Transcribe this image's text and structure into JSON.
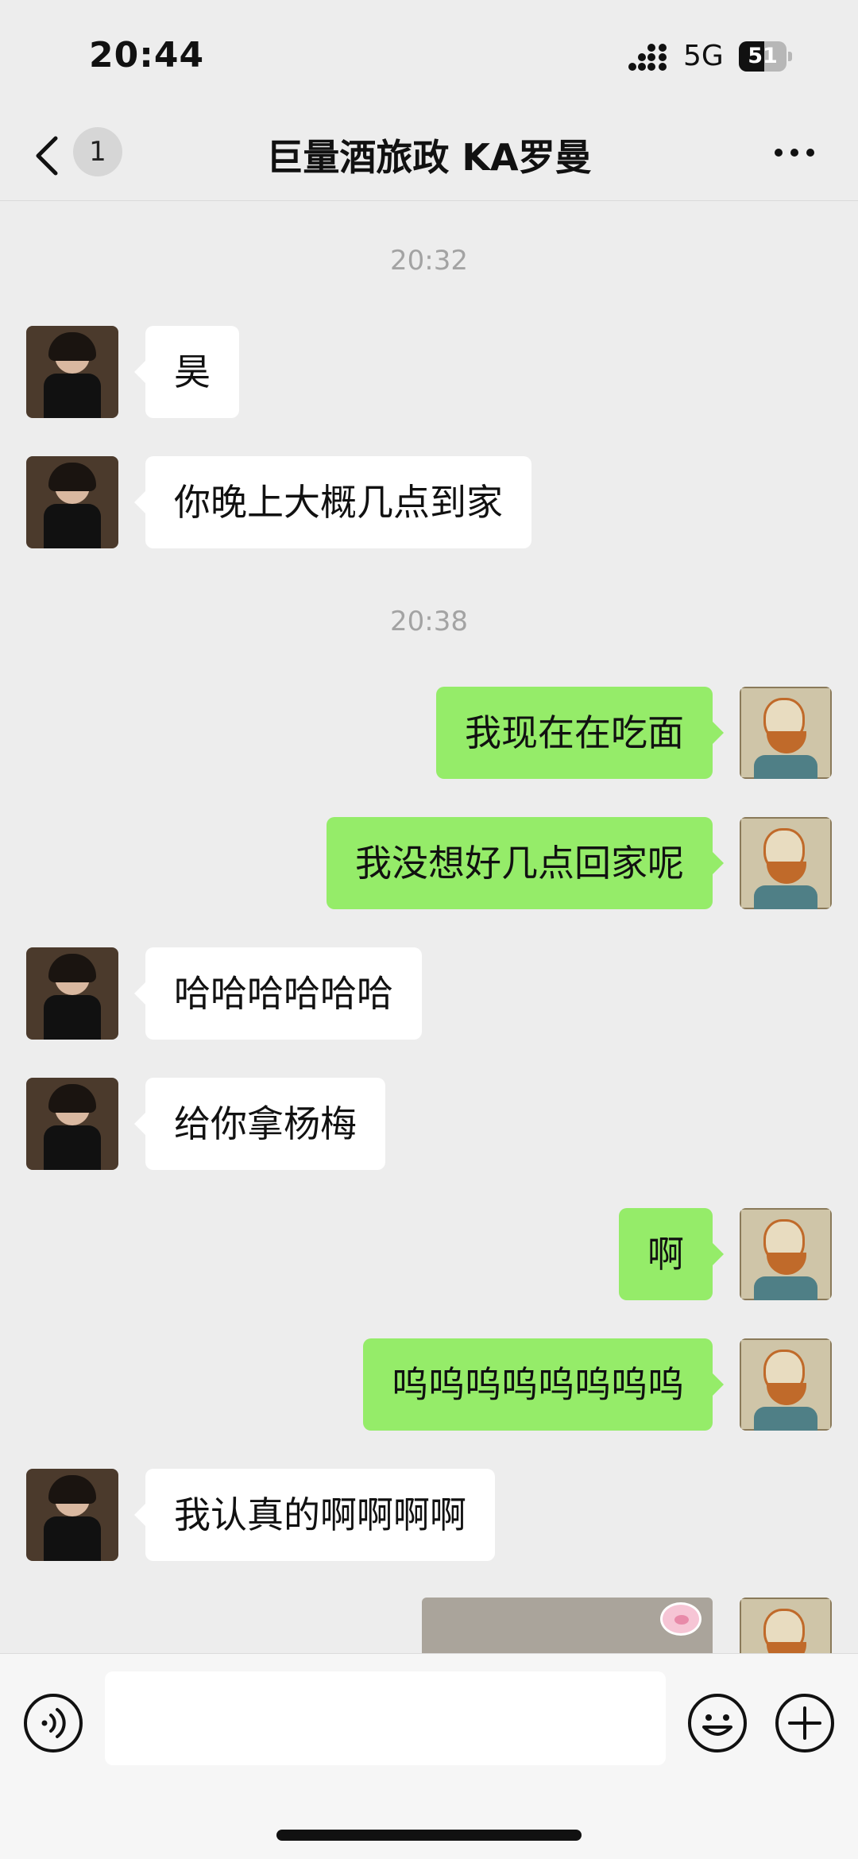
{
  "status_bar": {
    "time": "20:44",
    "network": "5G",
    "battery": "51"
  },
  "nav": {
    "back_label": "1",
    "title": "巨量酒旅政 KA罗曼"
  },
  "colors": {
    "background": "#ededed",
    "incoming_bubble": "#ffffff",
    "outgoing_bubble": "#95ec69",
    "accent_text": "#a3a3a3"
  },
  "timestamps": [
    "20:32",
    "20:38"
  ],
  "messages": [
    {
      "side": "in",
      "text": "昊"
    },
    {
      "side": "in",
      "text": "你晚上大概几点到家"
    },
    {
      "side": "out",
      "text": "我现在在吃面"
    },
    {
      "side": "out",
      "text": "我没想好几点回家呢"
    },
    {
      "side": "in",
      "text": "哈哈哈哈哈哈"
    },
    {
      "side": "in",
      "text": "给你拿杨梅"
    },
    {
      "side": "out",
      "text": "啊"
    },
    {
      "side": "out",
      "text": "呜呜呜呜呜呜呜呜"
    },
    {
      "side": "in",
      "text": "我认真的啊啊啊啊"
    }
  ],
  "image_message": {
    "side": "out",
    "type": "image"
  },
  "input_bar": {
    "placeholder": "",
    "icons": [
      "voice-icon",
      "emoji-icon",
      "plus-icon"
    ]
  }
}
